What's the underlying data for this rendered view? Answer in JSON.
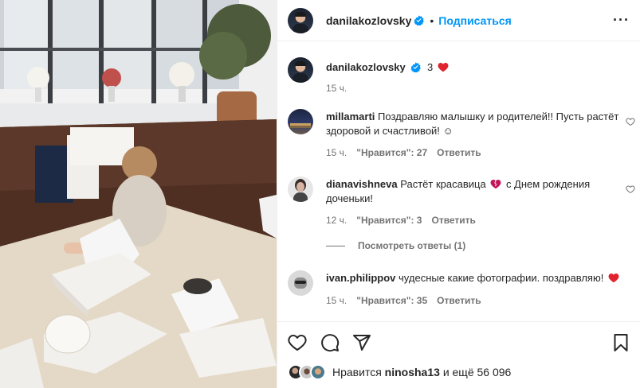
{
  "post": {
    "author": "danilakozlovsky",
    "follow_label": "Подписаться",
    "separator": "•",
    "more_label": "···"
  },
  "caption": {
    "username": "danilakozlovsky",
    "text": "3",
    "time": "15 ч."
  },
  "comments": [
    {
      "username": "millamarti",
      "text": "Поздравляю малышку и родителей!! Пусть растёт здоровой и счастливой! ☺",
      "time": "15 ч.",
      "likes_label": "\"Нравится\": 27",
      "reply_label": "Ответить"
    },
    {
      "username": "dianavishneva",
      "text_before": "Растёт красавица",
      "text_after": "с Днем рождения доченьки!",
      "time": "12 ч.",
      "likes_label": "\"Нравится\": 3",
      "reply_label": "Ответить"
    },
    {
      "username": "ivan.philippov",
      "text": "чудесные какие фотографии. поздравляю!",
      "time": "15 ч.",
      "likes_label": "\"Нравится\": 35",
      "reply_label": "Ответить"
    }
  ],
  "view_replies_label": "Посмотреть ответы (1)",
  "likes": {
    "prefix": "Нравится",
    "user": "ninosha13",
    "suffix": "и ещё 56 096"
  },
  "icons": {
    "like": "heart-outline-icon",
    "comment": "comment-bubble-icon",
    "share": "paper-plane-icon",
    "save": "bookmark-icon",
    "verified": "verified-badge-icon"
  },
  "colors": {
    "link_blue": "#0095f6",
    "verified_blue": "#0095f6",
    "heart_red": "#e0242f",
    "meta_gray": "#737373",
    "text": "#262626"
  }
}
